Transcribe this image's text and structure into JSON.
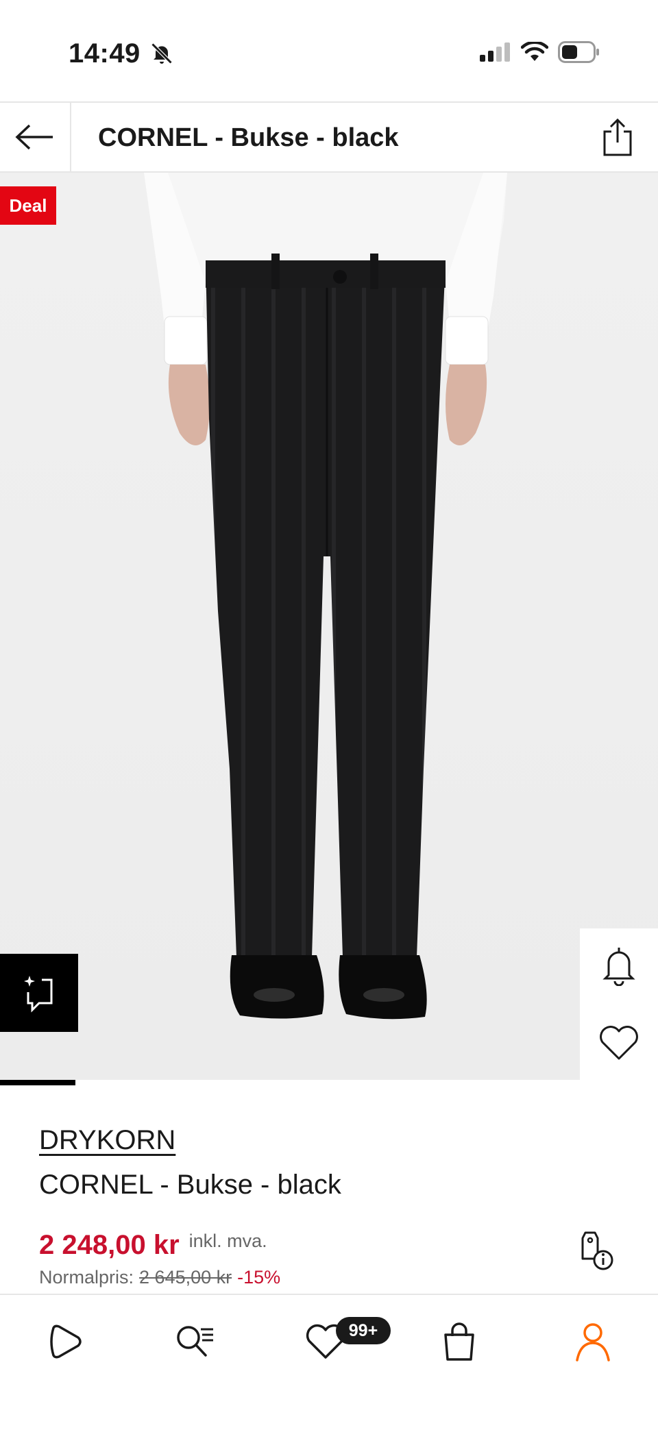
{
  "status_bar": {
    "time": "14:49",
    "icons": [
      "bell-slash-icon",
      "signal-icon",
      "wifi-icon",
      "battery-icon"
    ]
  },
  "header": {
    "title": "CORNEL - Bukse - black",
    "back_icon": "arrow-left-icon",
    "share_icon": "share-icon"
  },
  "image": {
    "badge": "Deal",
    "similar_icon": "similar-items-icon",
    "actions": [
      "bell-icon",
      "heart-icon"
    ],
    "gallery_progress": 0.14
  },
  "product": {
    "brand": "DRYKORN",
    "name": "CORNEL - Bukse - black",
    "price": "2 248,00 kr",
    "vat_label": "inkl. mva.",
    "normal_price_label": "Normalpris:",
    "old_price": "2 645,00 kr",
    "discount": "-15%",
    "price_info_icon": "price-tag-info-icon"
  },
  "bottom_nav": {
    "items": [
      "home-icon",
      "search-list-icon",
      "wishlist-icon",
      "bag-icon",
      "profile-icon"
    ],
    "wishlist_badge": "99+",
    "accent": "#ff6900"
  },
  "colors": {
    "sale_red": "#c8102e",
    "deal_red": "#e30613"
  }
}
